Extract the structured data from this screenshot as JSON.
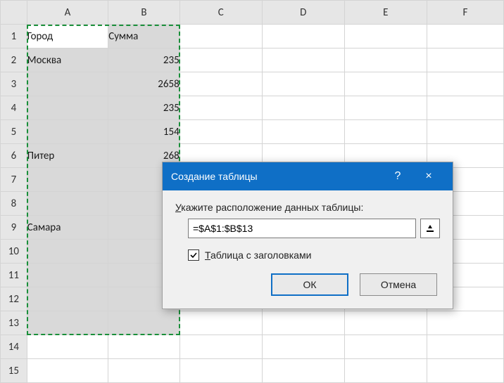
{
  "columns": [
    "A",
    "B",
    "C",
    "D",
    "E",
    "F"
  ],
  "rows": [
    "1",
    "2",
    "3",
    "4",
    "5",
    "6",
    "7",
    "8",
    "9",
    "10",
    "11",
    "12",
    "13",
    "14",
    "15"
  ],
  "cells": {
    "A1": "Город",
    "B1": "Сумма",
    "A2": "Москва",
    "B2": "235",
    "B3": "2658",
    "B4": "235",
    "B5": "154",
    "A6": "Питер",
    "B6": "268",
    "A9": "Самара"
  },
  "selection": {
    "range": "A1:B13",
    "active": "A1"
  },
  "dialog": {
    "title": "Создание таблицы",
    "help": "?",
    "close": "×",
    "label_prefix": "У",
    "label_rest": "кажите расположение данных таблицы:",
    "range_value": "=$A$1:$B$13",
    "checkbox_checked": true,
    "checkbox_prefix": "Т",
    "checkbox_rest": "аблица с заголовками",
    "ok": "ОК",
    "cancel": "Отмена"
  }
}
